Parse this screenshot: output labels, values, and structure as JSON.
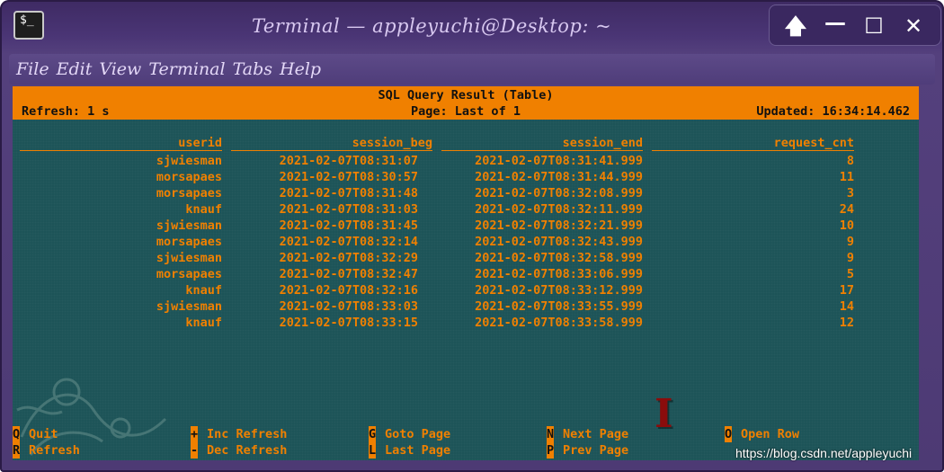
{
  "window": {
    "app_icon_text": "$_",
    "title": "Terminal — appleyuchi@Desktop: ~",
    "controls": {
      "up": "🡅",
      "minimize": "—",
      "maximize": "☐",
      "close": "✕"
    }
  },
  "menu": [
    "File",
    "Edit",
    "View",
    "Terminal",
    "Tabs",
    "Help"
  ],
  "header": {
    "title": "SQL Query Result (Table)",
    "refresh": "Refresh: 1 s",
    "page": "Page: Last of 1",
    "updated": "Updated: 16:34:14.462"
  },
  "table": {
    "columns": [
      "userid",
      "session_beg",
      "session_end",
      "request_cnt"
    ],
    "rows": [
      [
        "sjwiesman",
        "2021-02-07T08:31:07",
        "2021-02-07T08:31:41.999",
        "8"
      ],
      [
        "morsapaes",
        "2021-02-07T08:30:57",
        "2021-02-07T08:31:44.999",
        "11"
      ],
      [
        "morsapaes",
        "2021-02-07T08:31:48",
        "2021-02-07T08:32:08.999",
        "3"
      ],
      [
        "knauf",
        "2021-02-07T08:31:03",
        "2021-02-07T08:32:11.999",
        "24"
      ],
      [
        "sjwiesman",
        "2021-02-07T08:31:45",
        "2021-02-07T08:32:21.999",
        "10"
      ],
      [
        "morsapaes",
        "2021-02-07T08:32:14",
        "2021-02-07T08:32:43.999",
        "9"
      ],
      [
        "sjwiesman",
        "2021-02-07T08:32:29",
        "2021-02-07T08:32:58.999",
        "9"
      ],
      [
        "morsapaes",
        "2021-02-07T08:32:47",
        "2021-02-07T08:33:06.999",
        "5"
      ],
      [
        "knauf",
        "2021-02-07T08:32:16",
        "2021-02-07T08:33:12.999",
        "17"
      ],
      [
        "sjwiesman",
        "2021-02-07T08:33:03",
        "2021-02-07T08:33:55.999",
        "14"
      ],
      [
        "knauf",
        "2021-02-07T08:33:15",
        "2021-02-07T08:33:58.999",
        "12"
      ]
    ]
  },
  "footer": [
    {
      "key": "Q",
      "label": "Quit"
    },
    {
      "key": "R",
      "label": "Refresh"
    },
    {
      "key": "+",
      "label": "Inc Refresh"
    },
    {
      "key": "-",
      "label": "Dec Refresh"
    },
    {
      "key": "G",
      "label": "Goto Page"
    },
    {
      "key": "L",
      "label": "Last Page"
    },
    {
      "key": "N",
      "label": "Next Page"
    },
    {
      "key": "P",
      "label": "Prev Page"
    },
    {
      "key": "O",
      "label": "Open Row"
    }
  ],
  "cursor_glyph": "I",
  "watermark": "https://blog.csdn.net/appleyuchi",
  "colors": {
    "accent": "#f08000",
    "terminal_bg": "#1d5458",
    "window_frame": "#4d3a74"
  }
}
